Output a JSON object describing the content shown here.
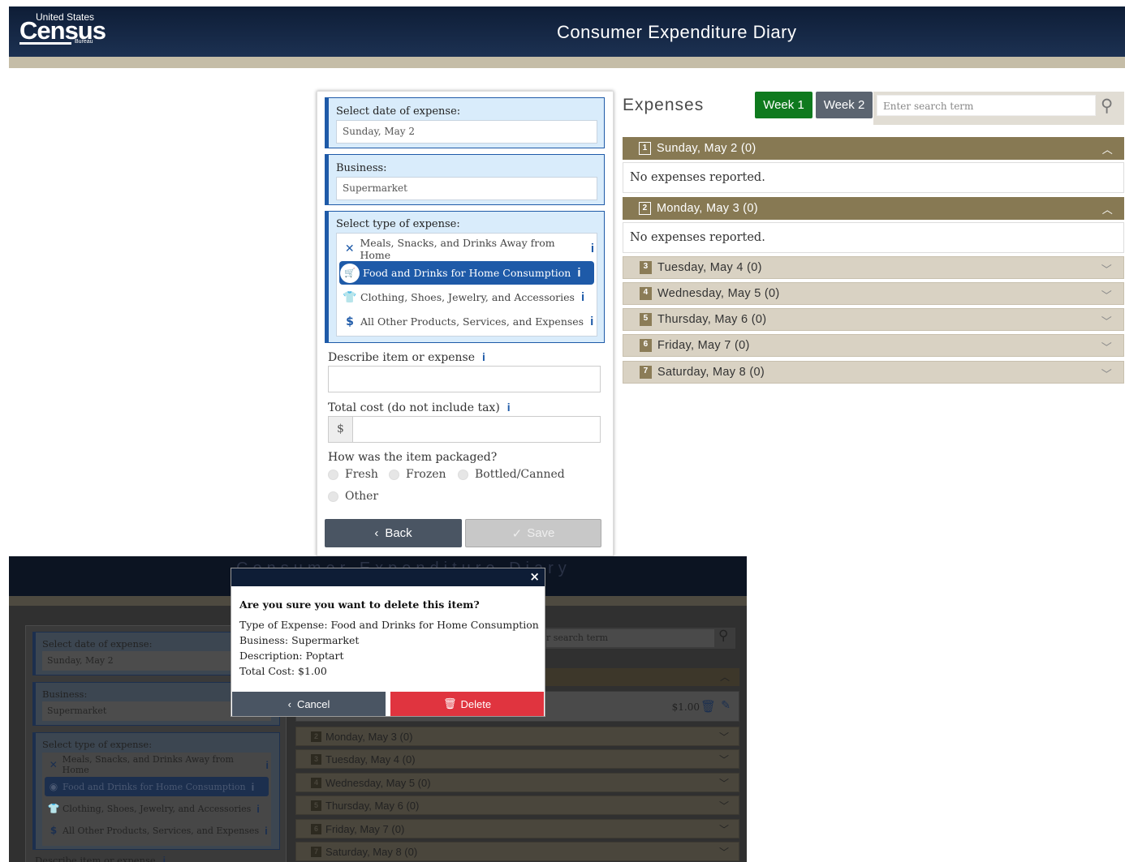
{
  "header": {
    "logo_top": "United States",
    "logo_main": "Census",
    "logo_sub": "Bureau",
    "title": "Consumer Expenditure Diary"
  },
  "form": {
    "date_label": "Select date of expense:",
    "date_value": "Sunday, May 2",
    "business_label": "Business:",
    "business_value": "Supermarket",
    "type_label": "Select type of expense:",
    "types": [
      {
        "icon": "utensils-icon",
        "label": "Meals, Snacks, and Drinks Away from Home",
        "selected": false
      },
      {
        "icon": "cart-icon",
        "label": "Food and Drinks for Home Consumption",
        "selected": true
      },
      {
        "icon": "shirt-icon",
        "label": "Clothing, Shoes, Jewelry, and Accessories",
        "selected": false
      },
      {
        "icon": "dollar-icon",
        "label": "All Other Products, Services, and Expenses",
        "selected": false
      }
    ],
    "info_glyph": "i",
    "describe_label": "Describe item or expense",
    "describe_value": "",
    "cost_label": "Total cost (do not include tax)",
    "cost_prefix": "$",
    "cost_value": "",
    "packaged_label": "How was the item packaged?",
    "packaged_options": [
      "Fresh",
      "Frozen",
      "Bottled/Canned",
      "Other"
    ],
    "back_label": "Back",
    "save_label": "Save"
  },
  "expenses": {
    "title": "Expenses",
    "week1": "Week 1",
    "week2": "Week 2",
    "search_placeholder": "Enter search term",
    "no_expenses": "No expenses reported.",
    "days": [
      {
        "num": "1",
        "label": "Sunday, May 2 (0)",
        "open": true
      },
      {
        "num": "2",
        "label": "Monday, May 3 (0)",
        "open": true
      },
      {
        "num": "3",
        "label": "Tuesday, May 4 (0)",
        "open": false
      },
      {
        "num": "4",
        "label": "Wednesday, May 5 (0)",
        "open": false
      },
      {
        "num": "5",
        "label": "Thursday, May 6 (0)",
        "open": false
      },
      {
        "num": "6",
        "label": "Friday, May 7 (0)",
        "open": false
      },
      {
        "num": "7",
        "label": "Saturday, May 8 (0)",
        "open": false
      }
    ],
    "colors": {
      "week1": "#0f7a1e",
      "week2": "#5b6470",
      "open_day": "#877953",
      "closed_day": "#d9d2c3"
    }
  },
  "bg_screenshot": {
    "header_title": "Consumer Expenditure Diary",
    "date_label": "Select date of expense:",
    "date_value": "Sunday, May 2",
    "business_label": "Business:",
    "business_value": "Supermarket",
    "type_label": "Select type of expense:",
    "types": [
      "Meals, Snacks, and Drinks Away from Home",
      "Food and Drinks for Home Consumption",
      "Clothing, Shoes, Jewelry, and Accessories",
      "All Other Products, Services, and Expenses"
    ],
    "describe_label": "Describe item or expense",
    "search_placeholder": "r search term",
    "item_cost": "$1.00",
    "days": [
      {
        "num": "2",
        "label": "Monday, May 3 (0)"
      },
      {
        "num": "3",
        "label": "Tuesday, May 4 (0)"
      },
      {
        "num": "4",
        "label": "Wednesday, May 5 (0)"
      },
      {
        "num": "5",
        "label": "Thursday, May 6 (0)"
      },
      {
        "num": "6",
        "label": "Friday, May 7 (0)"
      },
      {
        "num": "7",
        "label": "Saturday, May 8 (0)"
      }
    ]
  },
  "modal": {
    "close": "×",
    "question": "Are you sure you want to delete this item?",
    "type_line": "Type of Expense: Food and Drinks for Home Consumption",
    "business_line": "Business: Supermarket",
    "description_line": "Description: Poptart",
    "cost_line": "Total Cost: $1.00",
    "cancel_label": "Cancel",
    "delete_label": "Delete",
    "colors": {
      "cancel": "#4a5563",
      "delete": "#e0343f"
    }
  }
}
